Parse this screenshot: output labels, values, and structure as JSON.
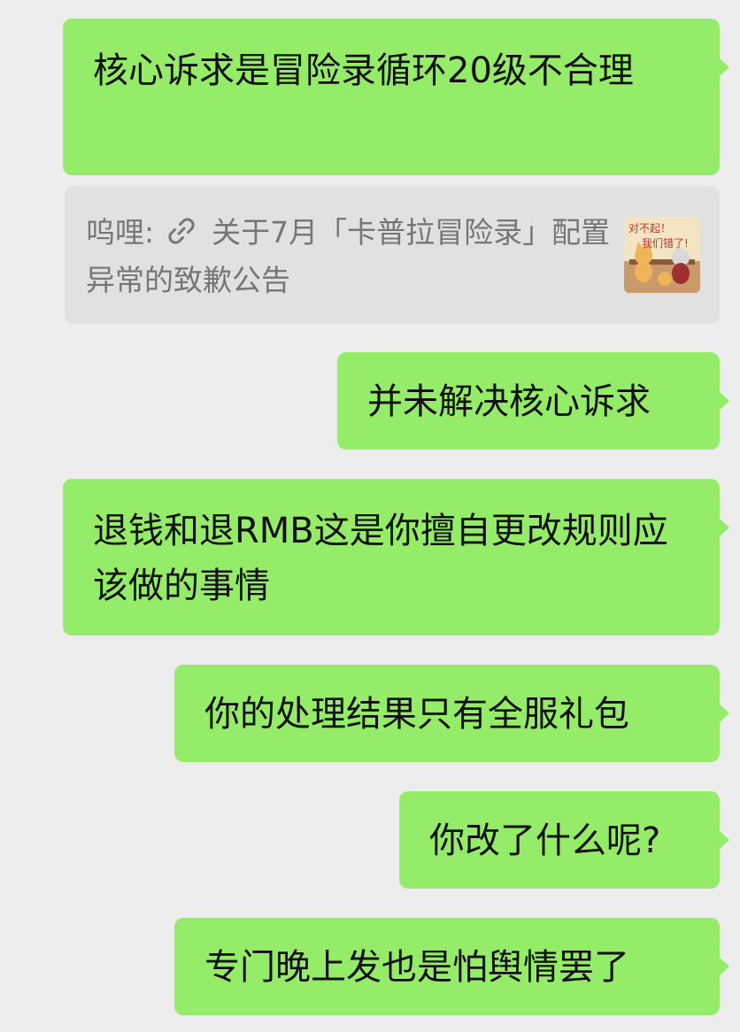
{
  "messages": [
    {
      "text": "核心诉求是冒险录循环20级不合理"
    },
    {
      "text": "并未解决核心诉求"
    },
    {
      "text": "退钱和退RMB这是你擅自更改规则应该做的事情"
    },
    {
      "text": "你的处理结果只有全服礼包"
    },
    {
      "text": "你改了什么呢?"
    },
    {
      "text": "专门晚上发也是怕舆情罢了"
    }
  ],
  "quote": {
    "sender": "呜哩:",
    "text": "关于7月「卡普拉冒险录」配置异常的致歉公告",
    "link_icon": "link-icon",
    "thumbnail_text_line1": "对不起！",
    "thumbnail_text_line2": "我们错了!"
  },
  "colors": {
    "background": "#ededed",
    "sent_bubble": "#95ec69",
    "quote_background": "#e1e1e1",
    "quote_text": "#767676"
  }
}
